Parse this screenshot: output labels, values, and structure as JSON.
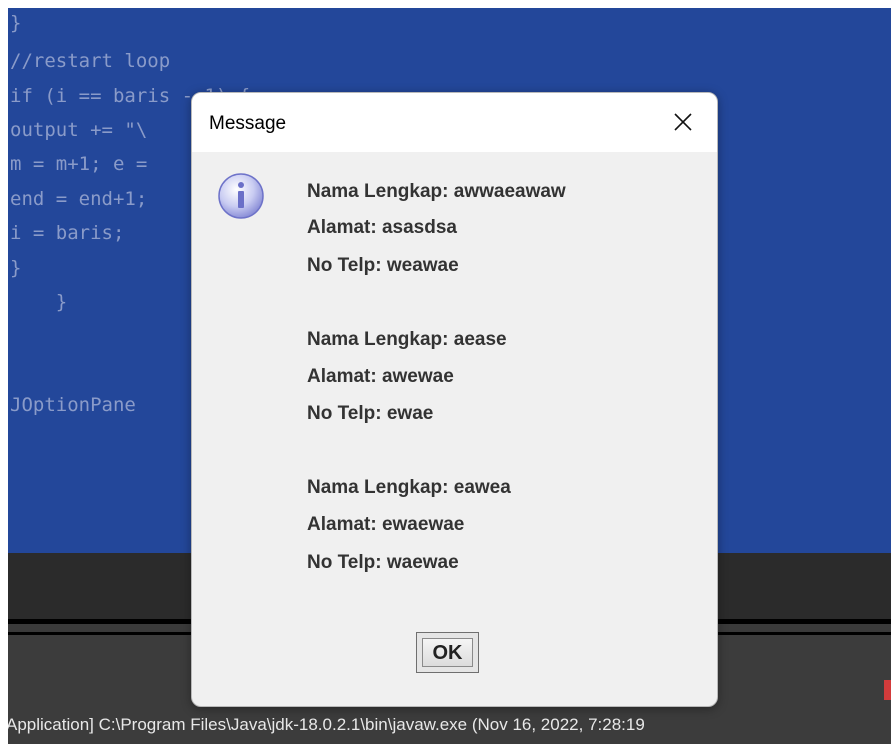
{
  "editor": {
    "lines": [
      "}",
      "//restart loop",
      "if (i == baris - 1) {",
      "output += \"\\",
      "m = m+1; e =",
      "end = end+1;",
      "i = baris;",
      "}",
      "    }",
      "",
      "",
      "JOptionPane"
    ]
  },
  "console": {
    "status_text": "Application] C:\\Program Files\\Java\\jdk-18.0.2.1\\bin\\javaw.exe  (Nov 16, 2022, 7:28:19"
  },
  "dialog": {
    "title": "Message",
    "icon": "info-icon",
    "records": [
      {
        "nama": "Nama Lengkap: awwaeawaw",
        "alamat": "Alamat: asasdsa",
        "telp": "No Telp: weawae"
      },
      {
        "nama": "Nama Lengkap: aease",
        "alamat": "Alamat: awewae",
        "telp": "No Telp: ewae"
      },
      {
        "nama": "Nama Lengkap: eawea",
        "alamat": "Alamat: ewaewae",
        "telp": "No Telp: waewae"
      }
    ],
    "ok_label": "OK"
  },
  "colors": {
    "editor_bg": "#23479a",
    "dialog_bg": "#f0f0f0",
    "console_bg": "#3c3c3c"
  }
}
